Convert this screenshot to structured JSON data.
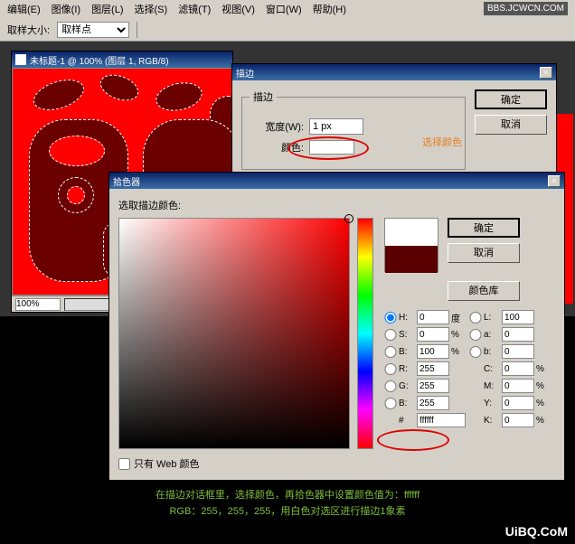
{
  "menu": {
    "items": [
      "编辑(E)",
      "图像(I)",
      "图层(L)",
      "选择(S)",
      "滤镜(T)",
      "视图(V)",
      "窗口(W)",
      "帮助(H)"
    ]
  },
  "watermark": "BBS.JCWCN.COM",
  "toolbar": {
    "label": "取样大小:",
    "option": "取样点"
  },
  "doc": {
    "title": "未标题-1 @ 100% (图层 1, RGB/8)",
    "zoom": "100%"
  },
  "stroke": {
    "title": "描边",
    "group": "描边",
    "width_label": "宽度(W):",
    "width_value": "1 px",
    "color_label": "颜色:",
    "note": "选择颜色",
    "ok": "确定",
    "cancel": "取消"
  },
  "picker": {
    "title": "拾色器",
    "label": "选取描边颜色:",
    "ok": "确定",
    "cancel": "取消",
    "lib": "颜色库",
    "webonly": "只有 Web 颜色",
    "H": {
      "label": "H:",
      "val": "0",
      "unit": "度"
    },
    "S": {
      "label": "S:",
      "val": "0",
      "unit": "%"
    },
    "B": {
      "label": "B:",
      "val": "100",
      "unit": "%"
    },
    "L": {
      "label": "L:",
      "val": "100"
    },
    "a": {
      "label": "a:",
      "val": "0"
    },
    "b": {
      "label": "b:",
      "val": "0"
    },
    "R": {
      "label": "R:",
      "val": "255"
    },
    "G": {
      "label": "G:",
      "val": "255"
    },
    "Bc": {
      "label": "B:",
      "val": "255"
    },
    "C": {
      "label": "C:",
      "val": "0",
      "unit": "%"
    },
    "M": {
      "label": "M:",
      "val": "0",
      "unit": "%"
    },
    "Y": {
      "label": "Y:",
      "val": "0",
      "unit": "%"
    },
    "K": {
      "label": "K:",
      "val": "0",
      "unit": "%"
    },
    "hex_label": "#",
    "hex": "ffffff"
  },
  "caption": {
    "l1": "在描边对话框里，选择颜色，再拾色器中设置颜色值为：ffffff",
    "l2": "RGB：255，255，255，用白色对选区进行描边1象素"
  },
  "uibq": "UiBQ.CoM"
}
